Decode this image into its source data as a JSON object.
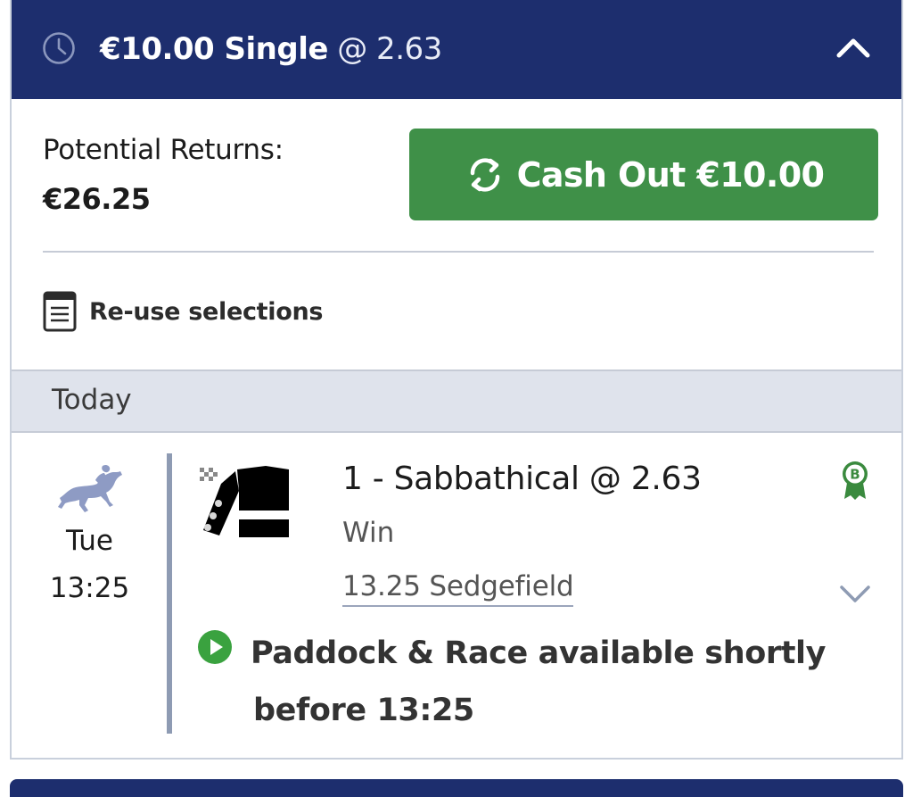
{
  "header": {
    "stake_label": "€10.00 Single",
    "odds_label": "@ 2.63",
    "icons": {
      "left": "clock-icon",
      "right": "chevron-up-icon"
    }
  },
  "returns": {
    "label": "Potential Returns:",
    "value": "€26.25"
  },
  "cashout": {
    "label": "Cash Out €10.00",
    "icon": "refresh-icon",
    "color": "#3f9048"
  },
  "reuse": {
    "label": "Re-use selections",
    "icon": "document-icon"
  },
  "section": {
    "label": "Today"
  },
  "bet": {
    "day": "Tue",
    "time": "13:25",
    "selection": "1 - Sabbathical @ 2.63",
    "market": "Win",
    "event": "13.25 Sedgefield",
    "badge_letter": "B",
    "notice_line1": "Paddock & Race available shortly",
    "notice_line2": "before 13:25",
    "icons": {
      "sport": "horse-racing-icon",
      "silks": "jockey-silks-icon",
      "badge": "bet-boost-badge-icon",
      "expand": "chevron-down-icon",
      "play": "play-icon"
    }
  },
  "colors": {
    "header_bg": "#1d2e6e",
    "cashout_bg": "#3f9048",
    "section_bg": "#dfe3ec",
    "play_green": "#3aa23f"
  }
}
